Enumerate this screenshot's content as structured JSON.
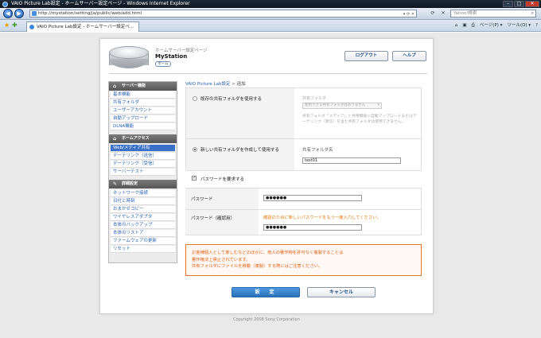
{
  "window": {
    "title": "VAIO Picture Lab設定 - ホームサーバー設定ページ - Windows Internet Explorer",
    "controls": {
      "minimize": "–",
      "maximize": "□",
      "close": "✕"
    }
  },
  "browser": {
    "url": "http://mystation/setting/ja/public/web/add.html",
    "search_placeholder": "Yahoo!検索",
    "tab_title": "VAIO Picture Lab設定 - ホームサーバー設定ペ...",
    "commands": {
      "home": "⌂",
      "feeds": "▣",
      "print": "⎙",
      "page": "ページ(P) ▾",
      "tools": "ツール(O) ▾",
      "help": "?"
    }
  },
  "header": {
    "subtitle": "ホームサーバー設定ページ",
    "station": "MyStation",
    "home_button": "ホーム",
    "logout_button": "ログアウト",
    "help_button": "ヘルプ"
  },
  "sidebar": {
    "sections": [
      {
        "title": "サーバー機能",
        "items": [
          "基本機能",
          "共有フォルダ",
          "ユーザーアカウント",
          "自動アップロード",
          "DLNA機能"
        ]
      },
      {
        "title": "ホームアクセス",
        "items": [
          "Web/メディア共有",
          "デーテリンク（送信）",
          "デーテリンク（受信）",
          "サーバーテスト"
        ]
      },
      {
        "title": "詳細設定",
        "items": [
          "ネットワーク接続",
          "日付と時刻",
          "おまかせコピー",
          "ワイヤレスアダプタ",
          "本体のバックアップ",
          "本体のリストア",
          "ファームウェアの更新",
          "リセット"
        ]
      }
    ]
  },
  "breadcrumb": {
    "parent": "VAIO Picture Lab設定",
    "separator": ">",
    "current": "追加"
  },
  "form": {
    "option_existing": "既存の共有フォルダを使用する",
    "existing_folder_label": "共有フォルダ",
    "existing_folder_select": "使用できる共有フォルダはありません",
    "existing_note": "共有フォルダ「メディア」と共用機能に自動アップロードまたはデーテリンク（受信）を含む共有フォルダは使用できません。",
    "option_new": "新しい共有フォルダを作成して使用する",
    "new_folder_label": "共有フォルダ名",
    "new_folder_value": "test01",
    "require_password": "パスワードを要求する",
    "password_label": "パスワード",
    "password_value": "●●●●●●",
    "password_confirm_label": "パスワード（確認用）",
    "password_confirm_hint": "確認のために新しいパスワードをもう一度入力してください。",
    "password_confirm_value": "●●●●●●",
    "caution_lines": [
      "お客様個人として楽しむなどのほかに、他人の著作物を許可なく複製することは",
      "著作権法上禁止されています。",
      "共有フォルダにファイルを移動（複製）する際にはご注意ください。"
    ],
    "ok_button": "設　定",
    "cancel_button": "キャンセル"
  },
  "footer": {
    "copyright": "Copyright 2008 Sony Corporation"
  }
}
